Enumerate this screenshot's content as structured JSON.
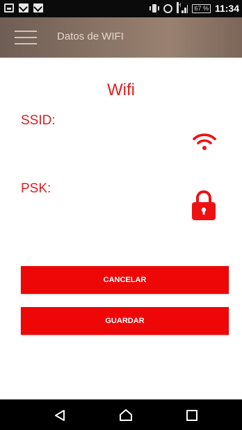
{
  "status_bar": {
    "left_icons": [
      "image-icon",
      "gmail-icon",
      "gmail-icon"
    ],
    "network_type": "H",
    "battery": "67 %",
    "time": "11:34"
  },
  "app_bar": {
    "title": "Datos de WIFI",
    "menu_icon": "hamburger-menu-icon"
  },
  "main": {
    "heading": "Wifi",
    "ssid_label": "SSID:",
    "psk_label": "PSK:",
    "wifi_icon": "wifi-icon",
    "lock_icon": "lock-icon"
  },
  "buttons": {
    "cancel_label": "CANCELAR",
    "save_label": "GUARDAR"
  },
  "nav_bar": {
    "icons": [
      "back-icon",
      "home-icon",
      "recents-icon"
    ]
  },
  "colors": {
    "accent": "#e21c1c",
    "button_bg": "#ee0707",
    "app_bar": "#8b7566"
  }
}
